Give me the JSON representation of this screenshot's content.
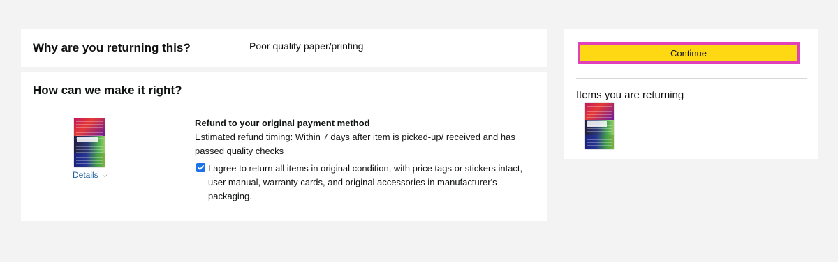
{
  "reason": {
    "heading": "Why are you returning this?",
    "value": "Poor quality paper/printing"
  },
  "resolution": {
    "heading": "How can we make it right?",
    "item": {
      "details_label": "Details",
      "details_icon": "chevron-down-icon"
    },
    "refund": {
      "title": "Refund to your original payment method",
      "description": "Estimated refund timing: Within 7 days after item is picked-up/ received and has passed quality checks"
    },
    "agreement": {
      "checked": true,
      "text": "I agree to return all items in original condition, with price tags or stickers intact, user manual, warranty cards, and original accessories in manufacturer's packaging."
    }
  },
  "sidebar": {
    "continue_label": "Continue",
    "items_heading": "Items you are returning"
  },
  "colors": {
    "page_background": "#f3f3f3",
    "panel_background": "#ffffff",
    "continue_button": "#ffd814",
    "highlight_border": "#e040b8",
    "link": "#2162a1",
    "checkbox": "#1a73e8"
  }
}
